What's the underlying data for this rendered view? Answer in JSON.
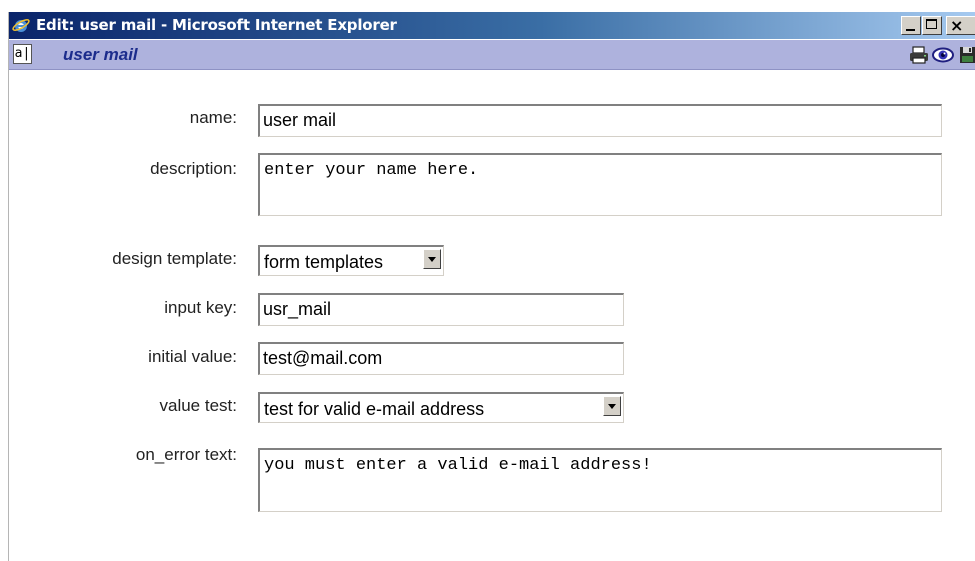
{
  "window": {
    "title": "Edit: user mail - Microsoft Internet Explorer",
    "controls": {
      "minimize": "minimize",
      "maximize": "maximize",
      "close": "×"
    }
  },
  "header": {
    "doc_icon_glyph": "a|",
    "title": "user mail",
    "icons": [
      "printer-icon",
      "eye-icon",
      "floppy-disk-icon"
    ]
  },
  "form": {
    "name": {
      "label": "name:",
      "value": "user mail"
    },
    "description": {
      "label": "description:",
      "value": "enter your name here."
    },
    "design_template": {
      "label": "design template:",
      "value": "form templates"
    },
    "input_key": {
      "label": "input key:",
      "value": "usr_mail"
    },
    "initial_value": {
      "label": "initial value:",
      "value": "test@mail.com"
    },
    "value_test": {
      "label": "value test:",
      "value": "test for valid e-mail address"
    },
    "on_error_text": {
      "label": "on_error text:",
      "value": "you must enter a valid e-mail address!"
    }
  },
  "colors": {
    "titlebar_start": "#0a246a",
    "titlebar_end": "#a6caf0",
    "header_bg": "#aeb2dd",
    "header_title": "#1c2c8c"
  }
}
